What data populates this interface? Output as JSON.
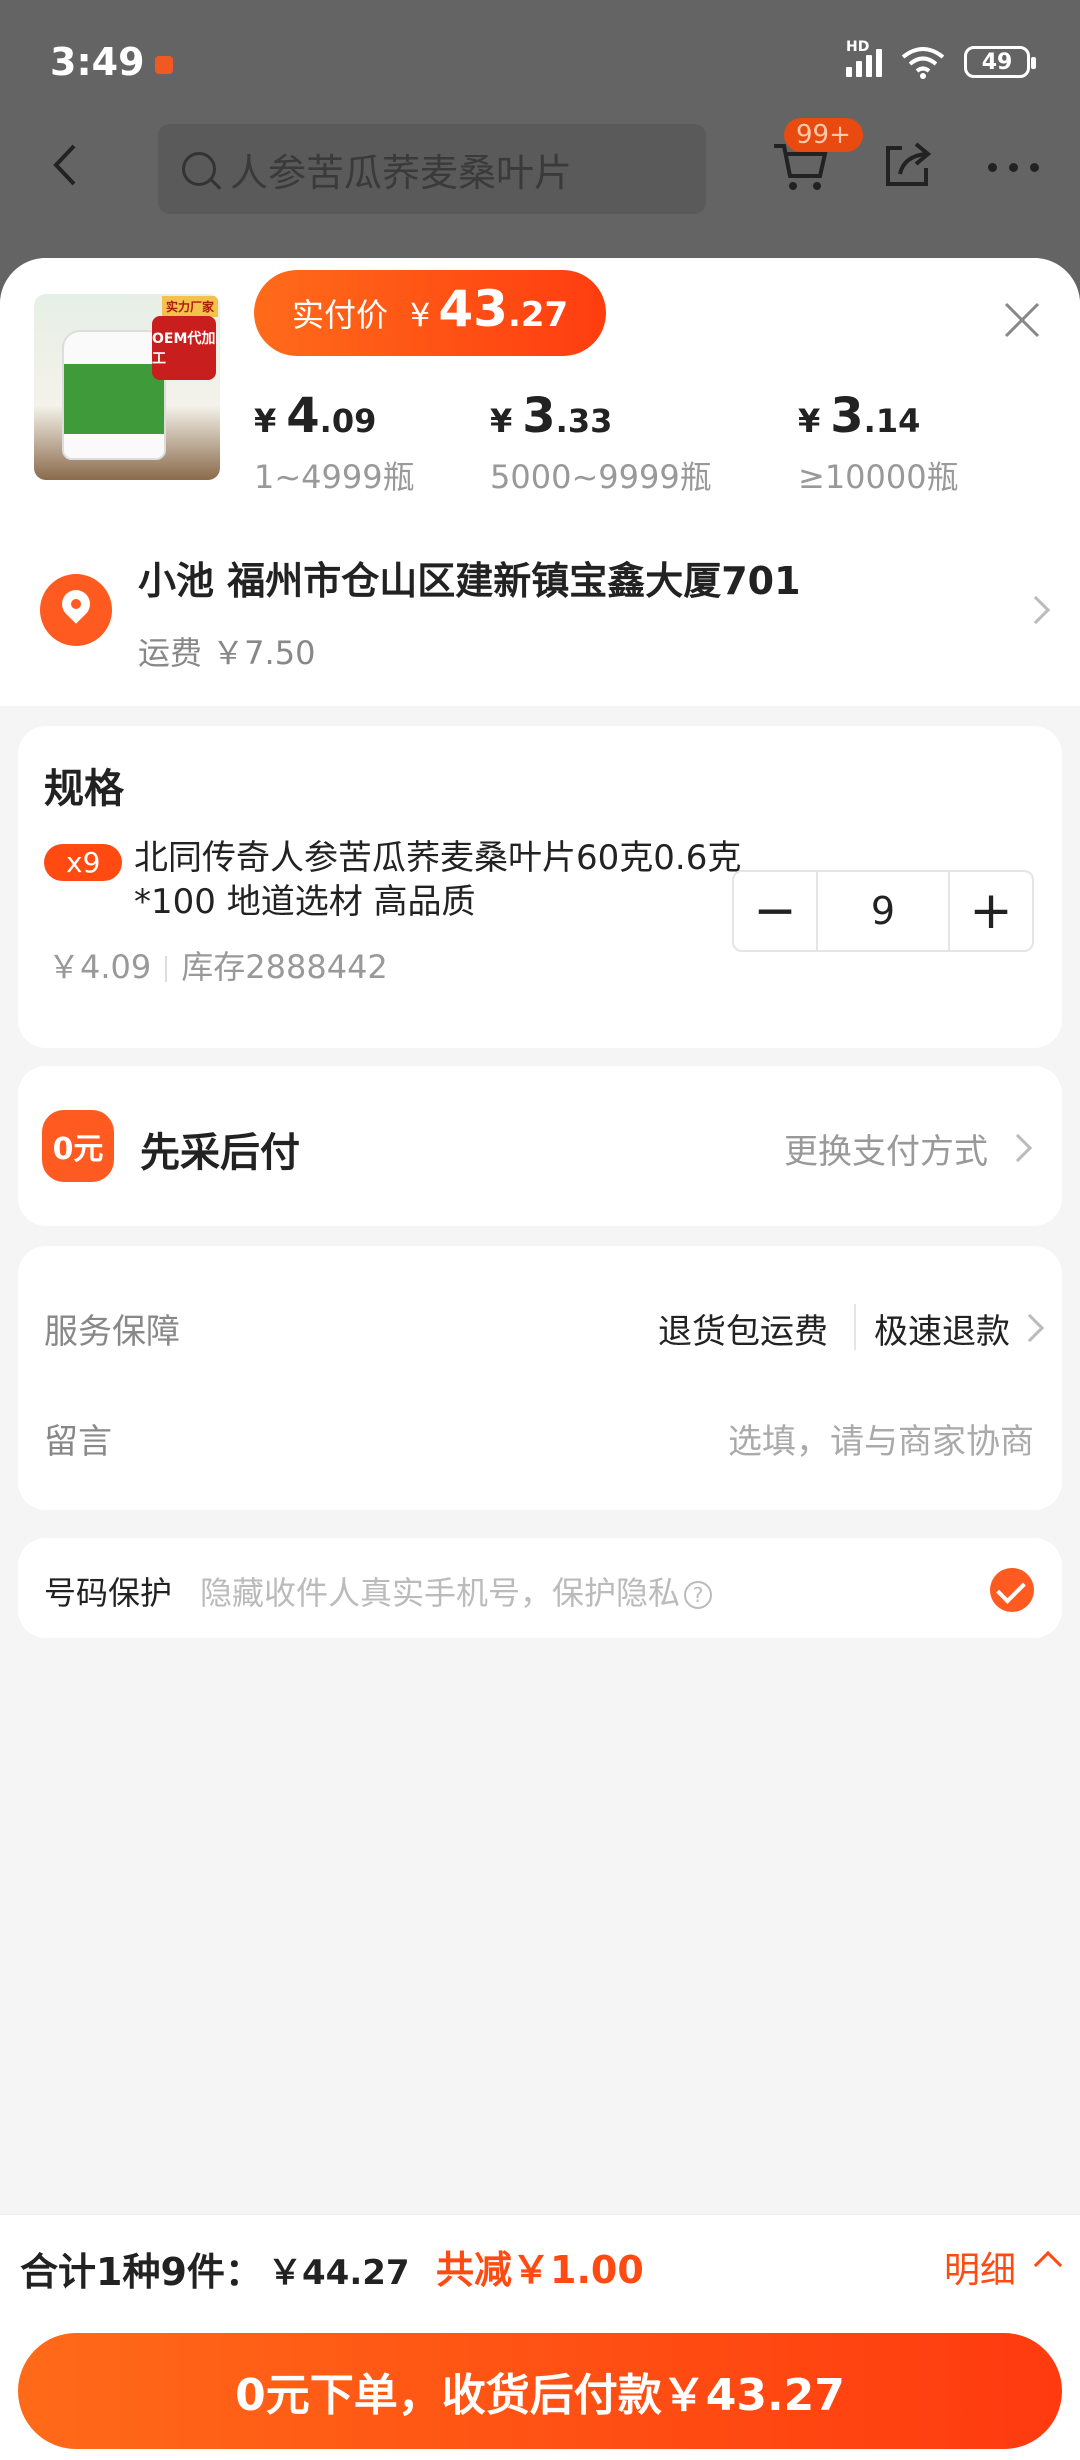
{
  "status_bar": {
    "time": "3:49",
    "battery": "49",
    "network": "HD"
  },
  "header": {
    "search_text": "人参苦瓜荞麦桑叶片",
    "cart_badge": "99+"
  },
  "product": {
    "paid_label": "实付价",
    "paid_currency": "¥",
    "paid_int": "43",
    "paid_dec": ".27",
    "image_tags": {
      "top": "实力厂家",
      "badge": "OEM代加工"
    },
    "tiers": [
      {
        "currency": "¥",
        "int": "4",
        "dec": ".09",
        "range": "1~4999瓶"
      },
      {
        "currency": "¥",
        "int": "3",
        "dec": ".33",
        "range": "5000~9999瓶"
      },
      {
        "currency": "¥",
        "int": "3",
        "dec": ".14",
        "range": "≥10000瓶"
      }
    ]
  },
  "address": {
    "line": "小池 福州市仓山区建新镇宝鑫大厦701",
    "shipping": "运费 ￥7.50"
  },
  "spec": {
    "title": "规格",
    "qty_badge": "x9",
    "name": "北同传奇人参苦瓜荞麦桑叶片60克0.6克*100 地道选材 高品质",
    "unit_price": "￥4.09",
    "stock": "库存2888442",
    "minus": "−",
    "quantity": "9",
    "plus": "+"
  },
  "payment": {
    "icon_text": "0元",
    "title": "先采后付",
    "change": "更换支付方式"
  },
  "service": {
    "label": "服务保障",
    "tag1": "退货包运费",
    "tag2": "极速退款",
    "message_label": "留言",
    "message_placeholder": "选填，请与商家协商"
  },
  "privacy": {
    "label": "号码保护",
    "hint": "隐藏收件人真实手机号，保护隐私",
    "help": "?",
    "checked": true
  },
  "footer": {
    "summary": "合计1种9件：",
    "total": "￥44.27",
    "reduce": "共减￥1.00",
    "detail": "明细",
    "cta": "0元下单，收货后付款￥43.27"
  },
  "colors": {
    "accent": "#ff4a12",
    "overlay": "#646464"
  }
}
